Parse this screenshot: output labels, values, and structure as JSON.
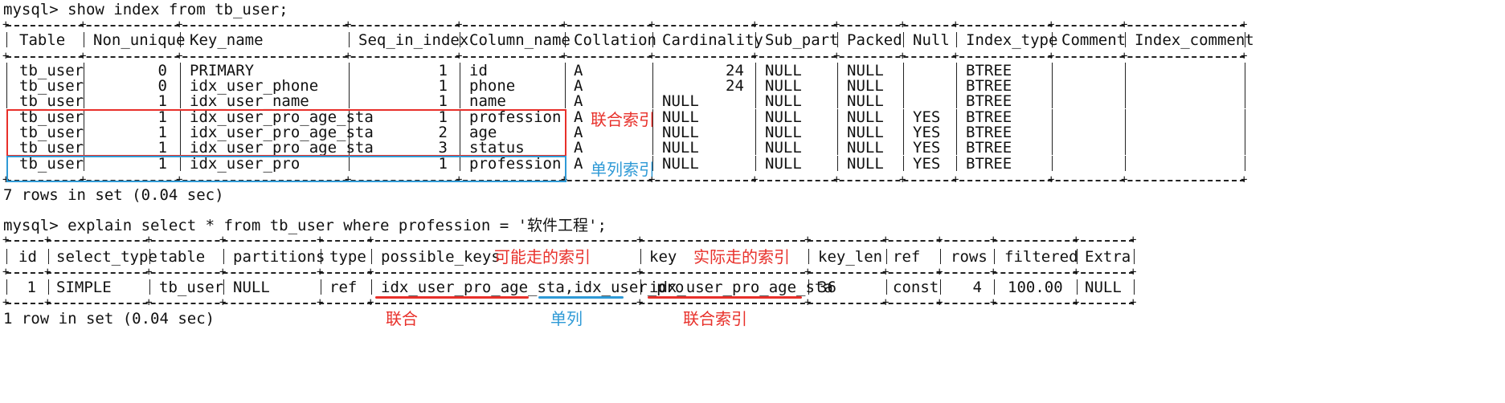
{
  "query1": {
    "prompt": "mysql> show index from tb_user;",
    "columns": [
      "Table",
      "Non_unique",
      "Key_name",
      "Seq_in_index",
      "Column_name",
      "Collation",
      "Cardinality",
      "Sub_part",
      "Packed",
      "Null",
      "Index_type",
      "Comment",
      "Index_comment"
    ],
    "rows": [
      [
        "tb_user",
        "0",
        "PRIMARY",
        "1",
        "id",
        "A",
        "24",
        "NULL",
        "NULL",
        "",
        "BTREE",
        "",
        ""
      ],
      [
        "tb_user",
        "0",
        "idx_user_phone",
        "1",
        "phone",
        "A",
        "24",
        "NULL",
        "NULL",
        "",
        "BTREE",
        "",
        ""
      ],
      [
        "tb_user",
        "1",
        "idx_user_name",
        "1",
        "name",
        "A",
        "NULL",
        "NULL",
        "NULL",
        "",
        "BTREE",
        "",
        ""
      ],
      [
        "tb_user",
        "1",
        "idx_user_pro_age_sta",
        "1",
        "profession",
        "A",
        "NULL",
        "NULL",
        "NULL",
        "YES",
        "BTREE",
        "",
        ""
      ],
      [
        "tb_user",
        "1",
        "idx_user_pro_age_sta",
        "2",
        "age",
        "A",
        "NULL",
        "NULL",
        "NULL",
        "YES",
        "BTREE",
        "",
        ""
      ],
      [
        "tb_user",
        "1",
        "idx_user_pro_age_sta",
        "3",
        "status",
        "A",
        "NULL",
        "NULL",
        "NULL",
        "YES",
        "BTREE",
        "",
        ""
      ],
      [
        "tb_user",
        "1",
        "idx_user_pro",
        "1",
        "profession",
        "A",
        "NULL",
        "NULL",
        "NULL",
        "YES",
        "BTREE",
        "",
        ""
      ]
    ],
    "result": "7 rows in set (0.04 sec)"
  },
  "query2": {
    "prompt": "mysql> explain select * from tb_user where profession = '软件工程';",
    "columns": [
      "id",
      "select_type",
      "table",
      "partitions",
      "type",
      "possible_keys",
      "key",
      "key_len",
      "ref",
      "rows",
      "filtered",
      "Extra"
    ],
    "row": [
      "1",
      "SIMPLE",
      "tb_user",
      "NULL",
      "ref",
      "idx_user_pro_age_sta,idx_user_pro",
      "idx_user_pro_age_sta",
      "36",
      "const",
      "4",
      "100.00",
      "NULL"
    ],
    "result": "1 row in set (0.04 sec)"
  },
  "annotations": {
    "composite_index": "联合索引",
    "single_index": "单列索引",
    "possible_index": "可能走的索引",
    "actual_index": "实际走的索引",
    "composite": "联合",
    "single": "单列",
    "composite_index_bottom": "联合索引"
  },
  "colors": {
    "red": "#e8302a",
    "blue": "#2f9ad6"
  }
}
